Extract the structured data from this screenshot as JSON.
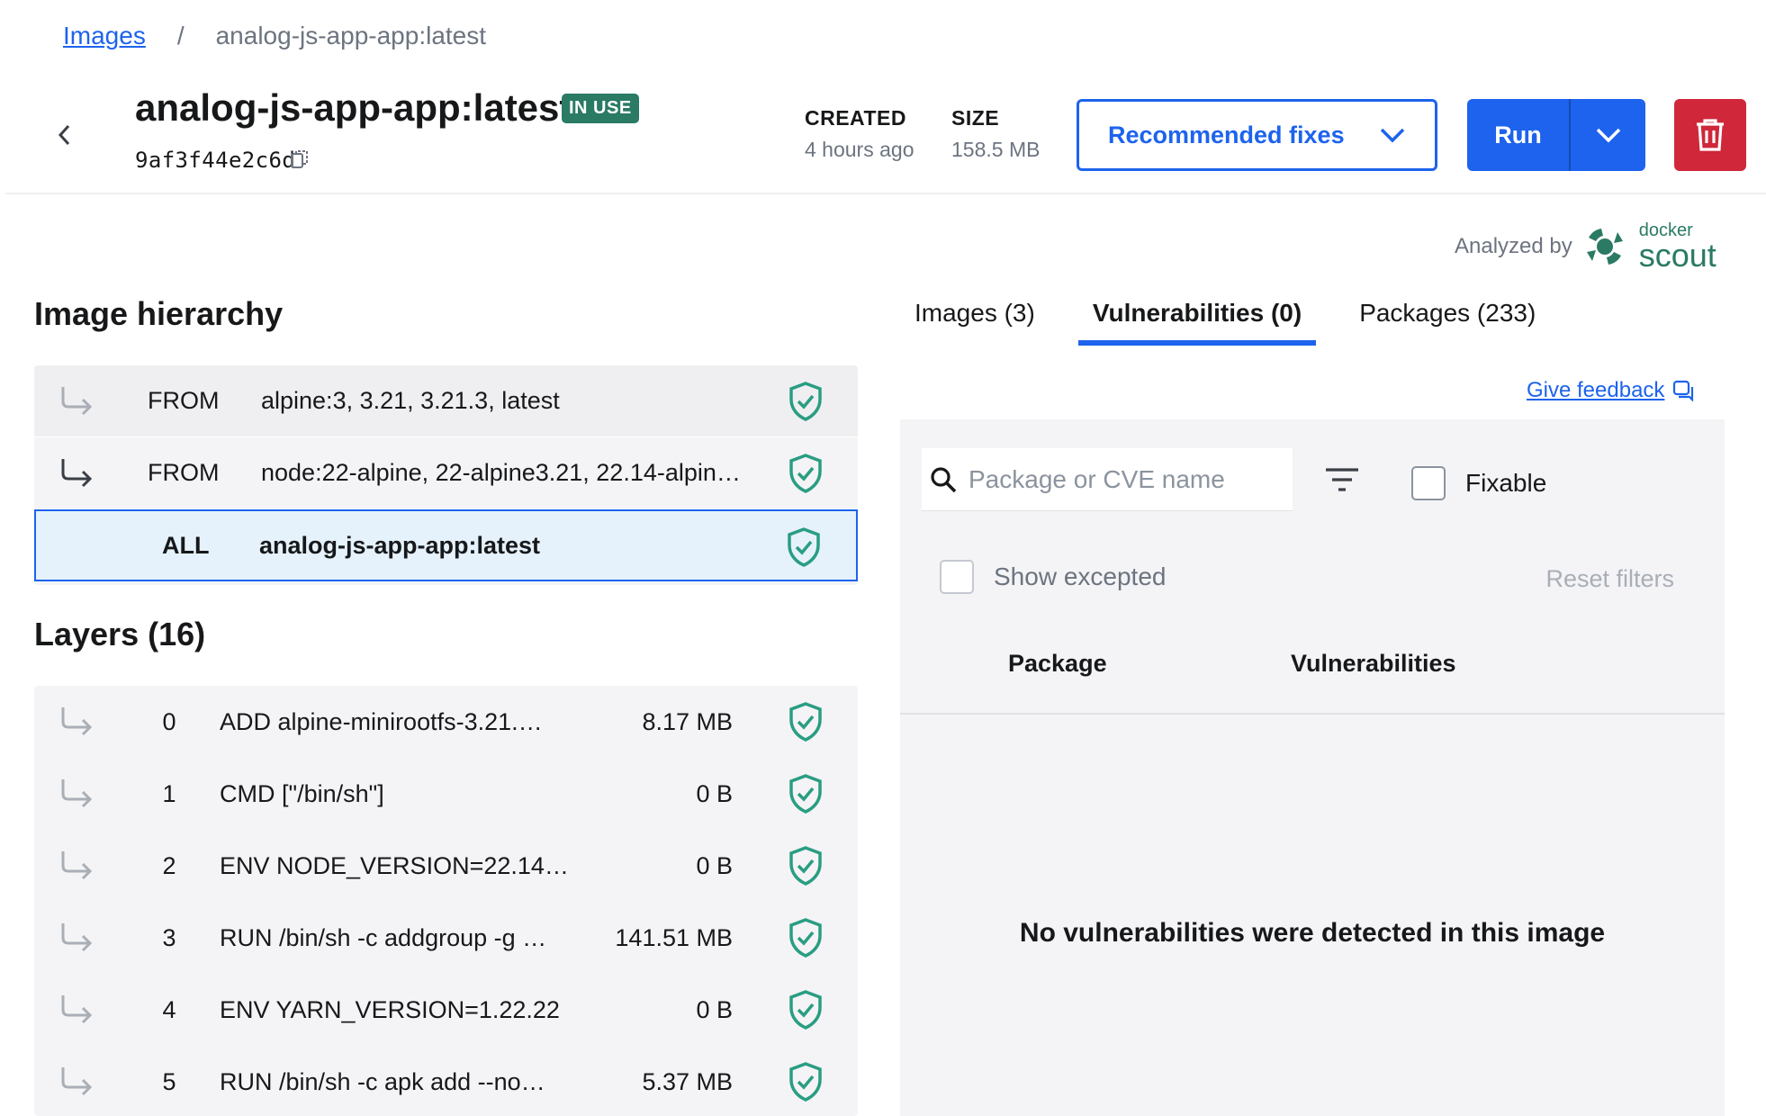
{
  "breadcrumb": {
    "parent": "Images",
    "separator": "/",
    "current": "analog-js-app-app:latest"
  },
  "header": {
    "title": "analog-js-app-app:latest",
    "badge": "IN USE",
    "hash": "9af3f44e2c6d",
    "created_label": "CREATED",
    "created_value": "4 hours ago",
    "size_label": "SIZE",
    "size_value": "158.5 MB",
    "recommended_fixes": "Recommended fixes",
    "run": "Run"
  },
  "analyzed": {
    "label": "Analyzed by",
    "brand_top": "docker",
    "brand_bottom": "scout"
  },
  "hierarchy": {
    "title": "Image hierarchy",
    "rows": [
      {
        "kind": "FROM",
        "name": "alpine:3, 3.21, 3.21.3, latest"
      },
      {
        "kind": "FROM",
        "name": "node:22-alpine, 22-alpine3.21, 22.14-alpin…"
      },
      {
        "kind": "ALL",
        "name": "analog-js-app-app:latest"
      }
    ]
  },
  "layers": {
    "title": "Layers (16)",
    "rows": [
      {
        "index": "0",
        "command": "ADD alpine-minirootfs-3.21.…",
        "size": "8.17 MB"
      },
      {
        "index": "1",
        "command": "CMD [\"/bin/sh\"]",
        "size": "0 B"
      },
      {
        "index": "2",
        "command": "ENV NODE_VERSION=22.14…",
        "size": "0 B"
      },
      {
        "index": "3",
        "command": "RUN /bin/sh -c addgroup -g …",
        "size": "141.51 MB"
      },
      {
        "index": "4",
        "command": "ENV YARN_VERSION=1.22.22",
        "size": "0 B"
      },
      {
        "index": "5",
        "command": "RUN /bin/sh -c apk add --no…",
        "size": "5.37 MB"
      }
    ]
  },
  "tabs": [
    {
      "label": "Images (3)"
    },
    {
      "label": "Vulnerabilities (0)"
    },
    {
      "label": "Packages (233)"
    }
  ],
  "feedback": "Give feedback",
  "vulnerabilities": {
    "search_placeholder": "Package or CVE name",
    "fixable": "Fixable",
    "show_excepted": "Show excepted",
    "reset_filters": "Reset filters",
    "col_package": "Package",
    "col_vulnerabilities": "Vulnerabilities",
    "empty_message": "No vulnerabilities were detected in this image"
  },
  "colors": {
    "accent": "#1d63ed",
    "danger": "#d0273a",
    "brand_green": "#2a7a64"
  },
  "icons": [
    "chevron-left-icon",
    "copy-icon",
    "chevron-down-icon",
    "trash-icon",
    "docker-scout-logo",
    "corner-arrow-icon",
    "shield-check-icon",
    "search-icon",
    "filter-icon",
    "feedback-icon"
  ]
}
